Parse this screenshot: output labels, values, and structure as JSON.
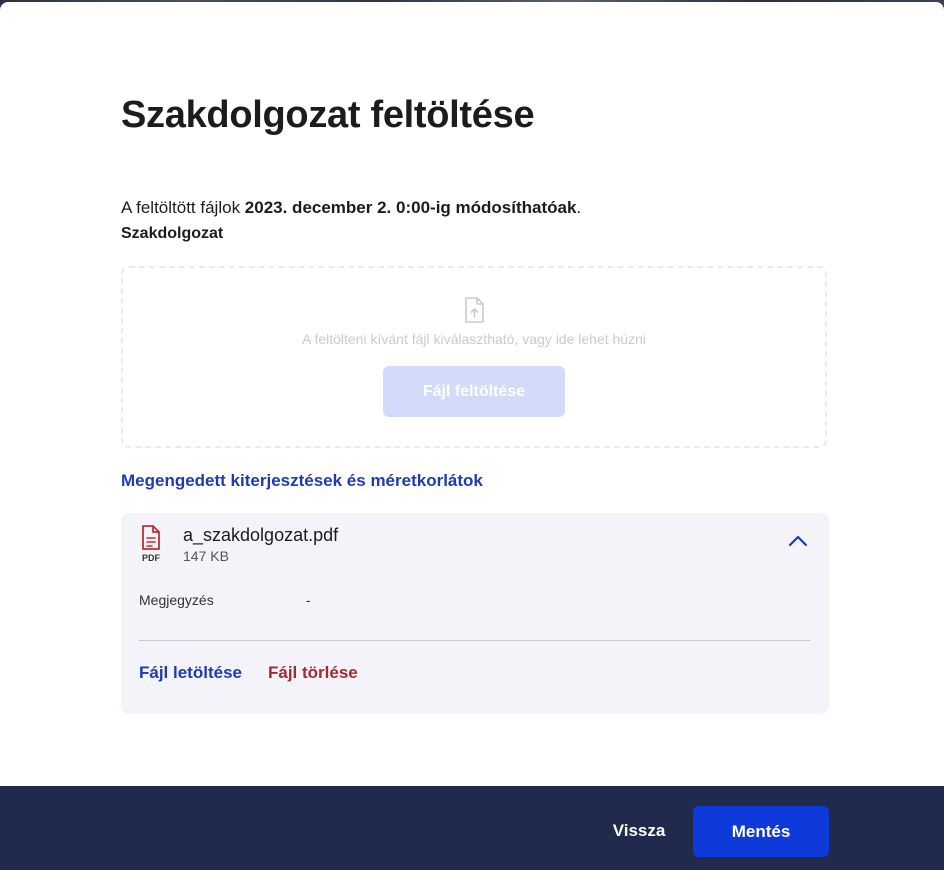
{
  "modal": {
    "title": "Szakdolgozat feltöltése",
    "deadline_prefix": "A feltöltött fájlok ",
    "deadline_date": "2023. december 2. 0:00-ig módosíthatóak",
    "deadline_suffix": ".",
    "section_label": "Szakdolgozat"
  },
  "dropzone": {
    "icon": "file-upload-icon",
    "hint": "A feltölteni kívánt fájl kiválasztható, vagy ide lehet húzni",
    "upload_button_label": "Fájl feltöltése"
  },
  "limits_link_label": "Megengedett kiterjesztések és méretkorlátok",
  "file": {
    "icon": "pdf-file-icon",
    "type_tag": "PDF",
    "name": "a_szakdolgozat.pdf",
    "size": "147 KB",
    "toggle_icon": "chevron-up-icon",
    "note_label": "Megjegyzés",
    "note_value": "-",
    "download_label": "Fájl letöltése",
    "delete_label": "Fájl törlése"
  },
  "footer": {
    "back_label": "Vissza",
    "save_label": "Mentés"
  },
  "colors": {
    "accent": "#0d3ad9",
    "link": "#1f3bb3",
    "danger": "#a12d2f",
    "footer_bg": "#1f2a4d",
    "card_bg": "#f3f3f9"
  }
}
